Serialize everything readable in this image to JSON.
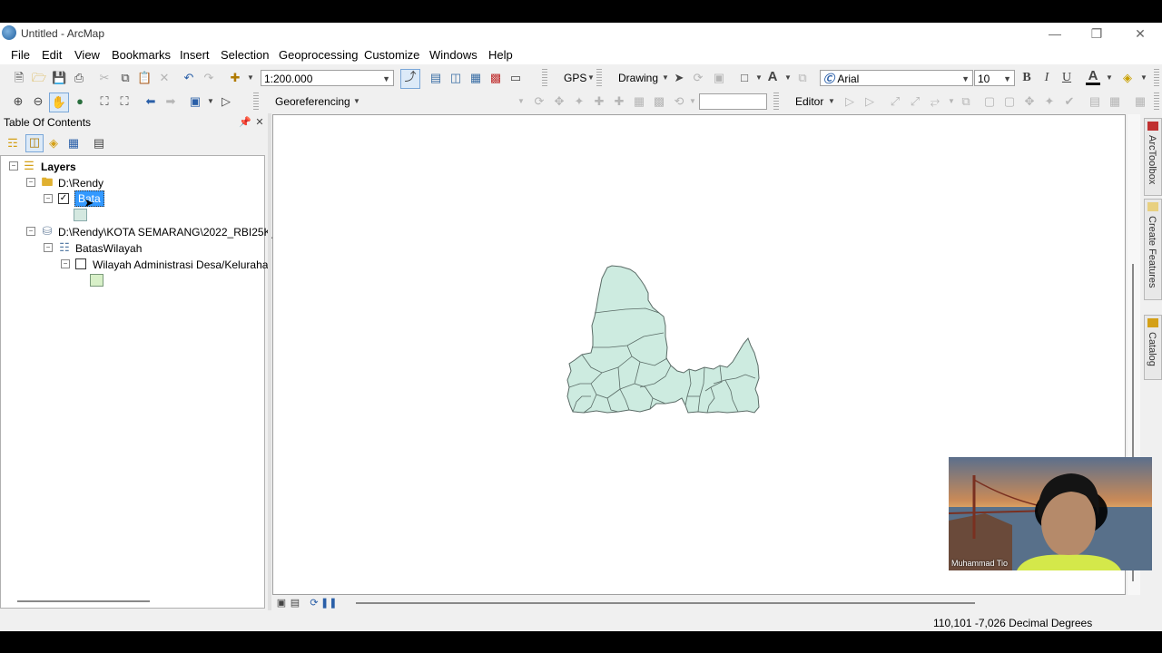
{
  "window": {
    "title": "Untitled - ArcMap"
  },
  "menu": [
    "File",
    "Edit",
    "View",
    "Bookmarks",
    "Insert",
    "Selection",
    "Geoprocessing",
    "Customize",
    "Windows",
    "Help"
  ],
  "toolbar": {
    "scale": "1:200.000",
    "gps_label": "GPS",
    "drawing_label": "Drawing",
    "font_name": "Arial",
    "font_size": "10",
    "bold": "B",
    "italic": "I",
    "underline": "U",
    "font_color": "A",
    "text_tool": "A",
    "georeferencing_label": "Georeferencing",
    "editor_label": "Editor"
  },
  "toc": {
    "title": "Table Of Contents",
    "layers_label": "Layers",
    "folder1": "D:\\Rendy",
    "layer1": "Bata",
    "folder2": "D:\\Rendy\\KOTA SEMARANG\\2022_RBI25K_",
    "dataset": "BatasWilayah",
    "layer2": "Wilayah Administrasi Desa/Keluraha"
  },
  "dock": {
    "toolbox": "ArcToolbox",
    "create_features": "Create Features",
    "catalog": "Catalog"
  },
  "status": {
    "coords": "110,101  -7,026 Decimal Degrees"
  },
  "webcam": {
    "name": "Muhammad Tio"
  },
  "colors": {
    "polygon_fill": "#cdebe0",
    "polygon_stroke": "#5a6b66",
    "selection": "#3399ff"
  }
}
